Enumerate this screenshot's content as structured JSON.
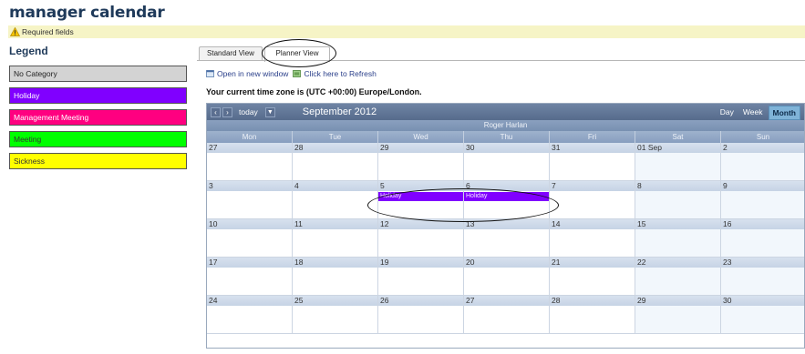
{
  "page": {
    "title": "manager calendar",
    "required_note": "Required fields"
  },
  "legend": {
    "title": "Legend",
    "items": [
      {
        "label": "No Category",
        "color": "#d3d3d3",
        "text_color": "#222222"
      },
      {
        "label": "Holiday",
        "color": "#8000ff",
        "text_color": "#ffffff"
      },
      {
        "label": "Management Meeting",
        "color": "#ff0080",
        "text_color": "#ffffff"
      },
      {
        "label": "Meeting",
        "color": "#00ff00",
        "text_color": "#333333"
      },
      {
        "label": "Sickness",
        "color": "#ffff00",
        "text_color": "#333333"
      }
    ]
  },
  "tabs": [
    {
      "label": "Standard View",
      "active": false
    },
    {
      "label": "Planner View",
      "active": true
    }
  ],
  "toolbar": {
    "open_new_window": "Open in new window",
    "refresh": "Click here to Refresh"
  },
  "timezone_text": "Your current time zone is (UTC +00:00) Europe/London.",
  "calendar": {
    "today_label": "today",
    "month_label": "September 2012",
    "views": [
      "Day",
      "Week",
      "Month"
    ],
    "active_view": "Month",
    "person": "Roger Harlan",
    "days_of_week": [
      "Mon",
      "Tue",
      "Wed",
      "Thu",
      "Fri",
      "Sat",
      "Sun"
    ],
    "weeks": [
      [
        "27",
        "28",
        "29",
        "30",
        "31",
        "01 Sep",
        "2"
      ],
      [
        "3",
        "4",
        "5",
        "6",
        "7",
        "8",
        "9"
      ],
      [
        "10",
        "11",
        "12",
        "13",
        "14",
        "15",
        "16"
      ],
      [
        "17",
        "18",
        "19",
        "20",
        "21",
        "22",
        "23"
      ],
      [
        "24",
        "25",
        "26",
        "27",
        "28",
        "29",
        "30"
      ]
    ],
    "events": [
      {
        "label": "Holiday",
        "week": 1,
        "day": 2
      },
      {
        "label": "Holiday",
        "week": 1,
        "day": 3
      }
    ]
  }
}
